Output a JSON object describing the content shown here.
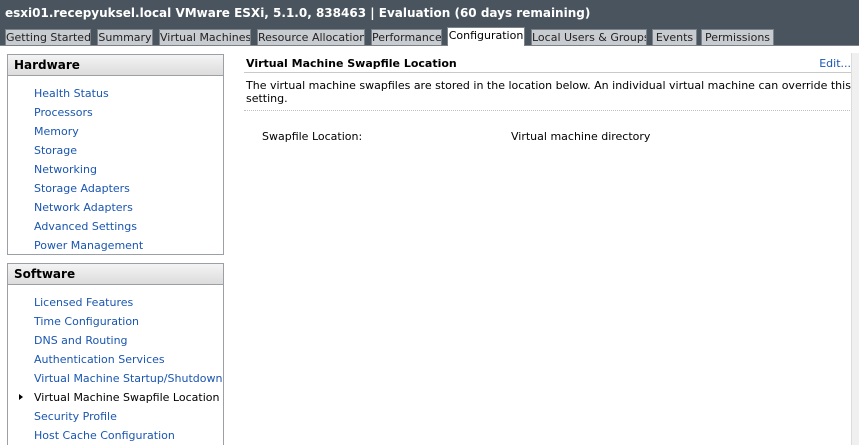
{
  "window": {
    "title": "esxi01.recepyuksel.local VMware ESXi, 5.1.0, 838463 | Evaluation (60 days remaining)"
  },
  "tabs": [
    {
      "label": "Getting Started"
    },
    {
      "label": "Summary"
    },
    {
      "label": "Virtual Machines"
    },
    {
      "label": "Resource Allocation"
    },
    {
      "label": "Performance"
    },
    {
      "label": "Configuration",
      "active": true
    },
    {
      "label": "Local Users & Groups"
    },
    {
      "label": "Events"
    },
    {
      "label": "Permissions"
    }
  ],
  "hardware": {
    "header": "Hardware",
    "items": [
      {
        "label": "Health Status"
      },
      {
        "label": "Processors"
      },
      {
        "label": "Memory"
      },
      {
        "label": "Storage"
      },
      {
        "label": "Networking"
      },
      {
        "label": "Storage Adapters"
      },
      {
        "label": "Network Adapters"
      },
      {
        "label": "Advanced Settings"
      },
      {
        "label": "Power Management"
      }
    ]
  },
  "software": {
    "header": "Software",
    "items": [
      {
        "label": "Licensed Features"
      },
      {
        "label": "Time Configuration"
      },
      {
        "label": "DNS and Routing"
      },
      {
        "label": "Authentication Services"
      },
      {
        "label": "Virtual Machine Startup/Shutdown"
      },
      {
        "label": "Virtual Machine Swapfile Location",
        "selected": true
      },
      {
        "label": "Security Profile"
      },
      {
        "label": "Host Cache Configuration"
      }
    ]
  },
  "main": {
    "title": "Virtual Machine Swapfile Location",
    "edit_label": "Edit...",
    "description": "The virtual machine swapfiles are stored in the location below. An individual virtual machine can override this setting.",
    "property_label": "Swapfile Location:",
    "property_value": "Virtual machine directory"
  },
  "colors": {
    "titlebar": "#4a545e",
    "link": "#1a56b0",
    "active_tab": "#ffffff",
    "inactive_tab": "#c8ccd0"
  }
}
